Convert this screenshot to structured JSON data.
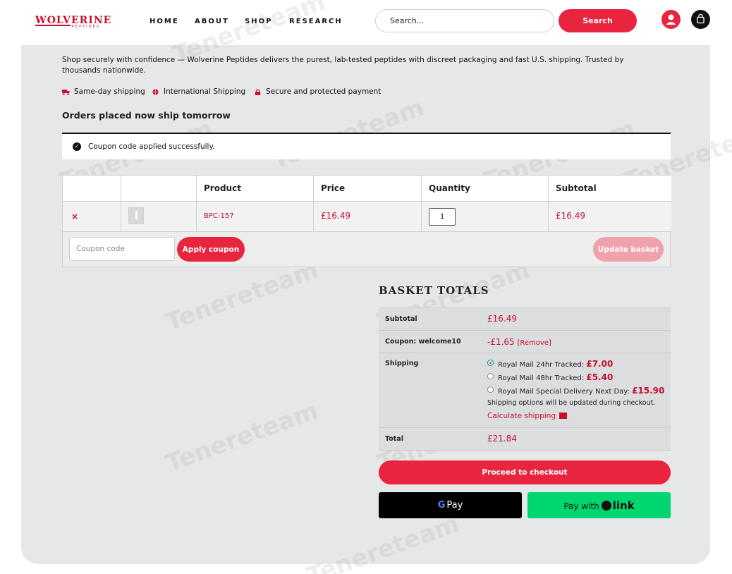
{
  "header": {
    "logo": {
      "main": "WOLVERINE",
      "sub": "PEPTIDES"
    },
    "nav": [
      "HOME",
      "ABOUT",
      "SHOP",
      "RESEARCH"
    ],
    "search_placeholder": "Search...",
    "search_button": "Search"
  },
  "intro": "Shop securely with confidence — Wolverine Peptides delivers the purest, lab-tested peptides with discreet packaging and fast U.S. shipping. Trusted by thousands nationwide.",
  "features": [
    "Same-day shipping",
    "International Shipping",
    "Secure and protected payment"
  ],
  "ship_note": "Orders placed now ship tomorrow",
  "notice": "Coupon code applied successfully.",
  "cart": {
    "headers": [
      "Product",
      "Price",
      "Quantity",
      "Subtotal"
    ],
    "item": {
      "remove": "×",
      "name": "BPC-157",
      "price": "£16.49",
      "quantity": "1",
      "subtotal": "£16.49"
    },
    "coupon_placeholder": "Coupon code",
    "apply_button": "Apply coupon",
    "update_button": "Update basket"
  },
  "totals": {
    "title": "Basket totals",
    "subtotal_label": "Subtotal",
    "subtotal_value": "£16.49",
    "coupon_label": "Coupon: welcome10",
    "coupon_value": "-£1.65",
    "coupon_remove": "[Remove]",
    "shipping_label": "Shipping",
    "shipping_options": [
      {
        "label": "Royal Mail 24hr Tracked:",
        "price": "£7.00",
        "selected": true
      },
      {
        "label": "Royal Mail 48hr Tracked:",
        "price": "£5.40",
        "selected": false
      },
      {
        "label": "Royal Mail Special Delivery Next Day:",
        "price": "£15.90",
        "selected": false
      }
    ],
    "shipping_note": "Shipping options will be updated during checkout.",
    "calculate_shipping": "Calculate shipping",
    "total_label": "Total",
    "total_value": "£21.84"
  },
  "checkout_button": "Proceed to checkout",
  "gpay_label": "Pay",
  "link_pay": {
    "prefix": "Pay with",
    "brand": "link"
  },
  "watermark": "Tenereteam",
  "colors": {
    "accent": "#e8243f",
    "brand": "#c8102e",
    "link_green": "#00d66f"
  }
}
